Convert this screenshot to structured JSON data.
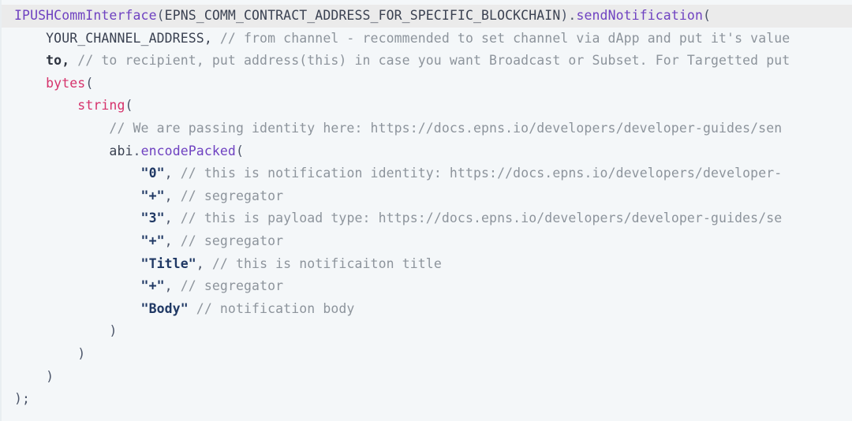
{
  "editor": {
    "language": "solidity",
    "background_color": "#f4f7f9",
    "highlight_line_color": "#ebebeb",
    "colors": {
      "type": "#6f42c1",
      "function": "#6f42c1",
      "keyword": "#d6336c",
      "string": "#1f3864",
      "comment": "#8d949c",
      "plain": "#3b4252"
    }
  },
  "code": {
    "lines": [
      {
        "indent": 0,
        "highlighted": true,
        "tokens": [
          {
            "kind": "type",
            "text": "IPUSHCommInterface"
          },
          {
            "kind": "punct",
            "text": "("
          },
          {
            "kind": "plain",
            "text": "EPNS_COMM_CONTRACT_ADDRESS_FOR_SPECIFIC_BLOCKCHAIN"
          },
          {
            "kind": "punct",
            "text": ")."
          },
          {
            "kind": "function",
            "text": "sendNotification"
          },
          {
            "kind": "punct",
            "text": "("
          }
        ]
      },
      {
        "indent": 1,
        "highlighted": false,
        "tokens": [
          {
            "kind": "plain",
            "text": "YOUR_CHANNEL_ADDRESS,"
          },
          {
            "kind": "comment",
            "text": " // from channel - recommended to set channel via dApp and put it's value"
          }
        ]
      },
      {
        "indent": 1,
        "highlighted": false,
        "tokens": [
          {
            "kind": "ident",
            "text": "to,"
          },
          {
            "kind": "comment",
            "text": " // to recipient, put address(this) in case you want Broadcast or Subset. For Targetted put"
          }
        ]
      },
      {
        "indent": 1,
        "highlighted": false,
        "tokens": [
          {
            "kind": "keyword",
            "text": "bytes"
          },
          {
            "kind": "punct",
            "text": "("
          }
        ]
      },
      {
        "indent": 2,
        "highlighted": false,
        "tokens": [
          {
            "kind": "keyword",
            "text": "string"
          },
          {
            "kind": "punct",
            "text": "("
          }
        ]
      },
      {
        "indent": 3,
        "highlighted": false,
        "tokens": [
          {
            "kind": "comment",
            "text": "// We are passing identity here: https://docs.epns.io/developers/developer-guides/sen"
          }
        ]
      },
      {
        "indent": 3,
        "highlighted": false,
        "tokens": [
          {
            "kind": "plain",
            "text": "abi"
          },
          {
            "kind": "punct",
            "text": "."
          },
          {
            "kind": "function",
            "text": "encodePacked"
          },
          {
            "kind": "punct",
            "text": "("
          }
        ]
      },
      {
        "indent": 4,
        "highlighted": false,
        "tokens": [
          {
            "kind": "string",
            "text": "\"0\""
          },
          {
            "kind": "punct",
            "text": ","
          },
          {
            "kind": "comment",
            "text": " // this is notification identity: https://docs.epns.io/developers/developer-"
          }
        ]
      },
      {
        "indent": 4,
        "highlighted": false,
        "tokens": [
          {
            "kind": "string",
            "text": "\"+\""
          },
          {
            "kind": "punct",
            "text": ","
          },
          {
            "kind": "comment",
            "text": " // segregator"
          }
        ]
      },
      {
        "indent": 4,
        "highlighted": false,
        "tokens": [
          {
            "kind": "string",
            "text": "\"3\""
          },
          {
            "kind": "punct",
            "text": ","
          },
          {
            "kind": "comment",
            "text": " // this is payload type: https://docs.epns.io/developers/developer-guides/se"
          }
        ]
      },
      {
        "indent": 4,
        "highlighted": false,
        "tokens": [
          {
            "kind": "string",
            "text": "\"+\""
          },
          {
            "kind": "punct",
            "text": ","
          },
          {
            "kind": "comment",
            "text": " // segregator"
          }
        ]
      },
      {
        "indent": 4,
        "highlighted": false,
        "tokens": [
          {
            "kind": "string",
            "text": "\"Title\""
          },
          {
            "kind": "punct",
            "text": ","
          },
          {
            "kind": "comment",
            "text": " // this is notificaiton title"
          }
        ]
      },
      {
        "indent": 4,
        "highlighted": false,
        "tokens": [
          {
            "kind": "string",
            "text": "\"+\""
          },
          {
            "kind": "punct",
            "text": ","
          },
          {
            "kind": "comment",
            "text": " // segregator"
          }
        ]
      },
      {
        "indent": 4,
        "highlighted": false,
        "tokens": [
          {
            "kind": "string",
            "text": "\"Body\""
          },
          {
            "kind": "comment",
            "text": " // notification body"
          }
        ]
      },
      {
        "indent": 3,
        "highlighted": false,
        "tokens": [
          {
            "kind": "punct",
            "text": ")"
          }
        ]
      },
      {
        "indent": 2,
        "highlighted": false,
        "tokens": [
          {
            "kind": "punct",
            "text": ")"
          }
        ]
      },
      {
        "indent": 1,
        "highlighted": false,
        "tokens": [
          {
            "kind": "punct",
            "text": ")"
          }
        ]
      },
      {
        "indent": 0,
        "highlighted": false,
        "tokens": [
          {
            "kind": "punct",
            "text": ");"
          }
        ]
      }
    ]
  }
}
